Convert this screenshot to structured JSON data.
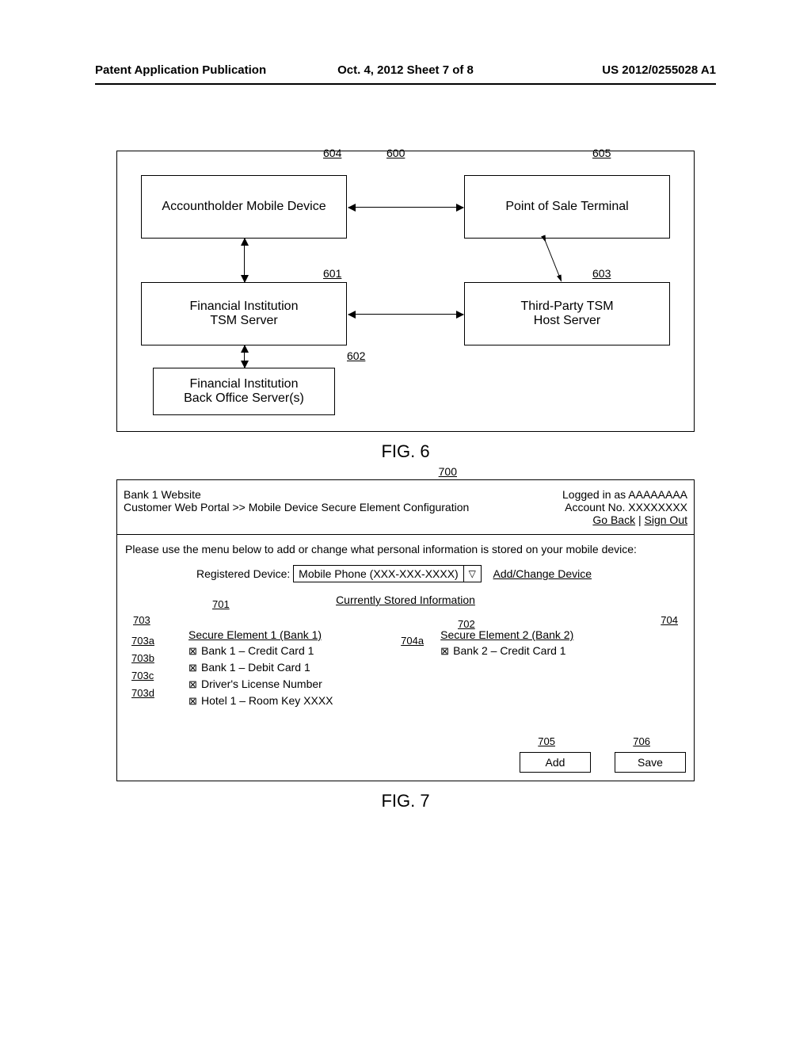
{
  "header": {
    "left": "Patent Application Publication",
    "mid": "Oct. 4, 2012   Sheet 7 of 8",
    "right": "US 2012/0255028 A1"
  },
  "fig6": {
    "caption": "FIG. 6",
    "refs": {
      "r600": "600",
      "r604": "604",
      "r605": "605",
      "r601": "601",
      "r603": "603",
      "r602": "602"
    },
    "boxes": {
      "b604": "Accountholder Mobile Device",
      "b605": "Point of Sale Terminal",
      "b601_line1": "Financial Institution",
      "b601_line2": "TSM Server",
      "b603_line1": "Third-Party TSM",
      "b603_line2": "Host Server",
      "b602_line1": "Financial Institution",
      "b602_line2": "Back Office Server(s)"
    }
  },
  "fig7": {
    "caption": "FIG. 7",
    "ref700": "700",
    "header": {
      "site": "Bank 1 Website",
      "breadcrumb": "Customer Web Portal >> Mobile Device Secure Element Configuration",
      "logged": "Logged in as AAAAAAAA",
      "acct": "Account No. XXXXXXXX",
      "goback": "Go Back",
      "signout": "Sign Out",
      "sep": " | "
    },
    "instr": "Please use the menu below to add or change what personal information is stored on your mobile device:",
    "device_label": "Registered Device:",
    "device_value": "Mobile Phone (XXX-XXX-XXXX)",
    "addchange": "Add/Change Device",
    "stored_heading": "Currently Stored Information",
    "refs": {
      "r701": "701",
      "r702": "702",
      "r703": "703",
      "r704": "704",
      "r703a": "703a",
      "r703b": "703b",
      "r703c": "703c",
      "r703d": "703d",
      "r704a": "704a",
      "r705": "705",
      "r706": "706"
    },
    "col1_title": "Secure Element 1 (Bank 1)",
    "col2_title": "Secure Element 2 (Bank 2)",
    "col1_items": [
      "Bank 1 – Credit Card 1",
      "Bank 1 – Debit Card 1",
      "Driver's License Number",
      "Hotel 1 – Room Key XXXX"
    ],
    "col2_items": [
      "Bank 2 – Credit Card 1"
    ],
    "btn_add": "Add",
    "btn_save": "Save"
  }
}
